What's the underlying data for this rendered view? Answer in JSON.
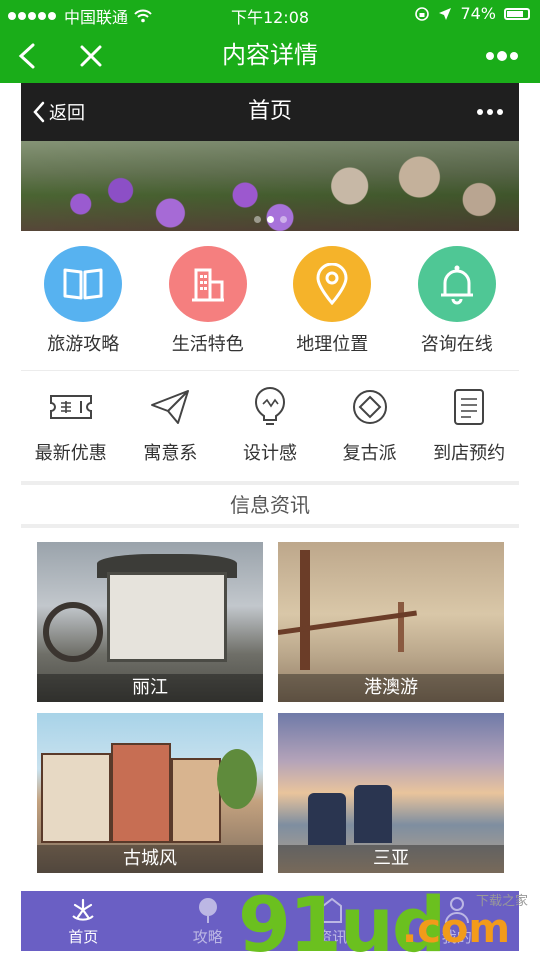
{
  "status": {
    "carrier": "中国联通",
    "time": "下午12:08",
    "battery": "74%"
  },
  "wx": {
    "title": "内容详情"
  },
  "mp": {
    "back_label": "返回",
    "title": "首页"
  },
  "banner": {
    "slides": 3,
    "active_index": 1
  },
  "categories": [
    {
      "label": "旅游攻略",
      "icon": "book-icon",
      "color": "#57b2f0"
    },
    {
      "label": "生活特色",
      "icon": "building-icon",
      "color": "#f57f7f"
    },
    {
      "label": "地理位置",
      "icon": "location-pin-icon",
      "color": "#f5b32a"
    },
    {
      "label": "咨询在线",
      "icon": "bell-icon",
      "color": "#4fc795"
    }
  ],
  "tools": [
    {
      "label": "最新优惠",
      "icon": "ticket-icon"
    },
    {
      "label": "寓意系",
      "icon": "paper-plane-icon"
    },
    {
      "label": "设计感",
      "icon": "lightbulb-icon"
    },
    {
      "label": "复古派",
      "icon": "diamond-icon"
    },
    {
      "label": "到店预约",
      "icon": "document-icon"
    }
  ],
  "section": {
    "title": "信息资讯"
  },
  "cards": [
    {
      "caption": "丽江"
    },
    {
      "caption": "港澳游"
    },
    {
      "caption": "古城风"
    },
    {
      "caption": "三亚"
    }
  ],
  "tabbar": [
    {
      "label": "首页",
      "active": true
    },
    {
      "label": "攻略",
      "active": false
    },
    {
      "label": "资讯",
      "active": false
    },
    {
      "label": "我的",
      "active": false
    }
  ],
  "watermark": {
    "text": "91ud",
    "suffix": ".com",
    "small": "下载之家"
  }
}
